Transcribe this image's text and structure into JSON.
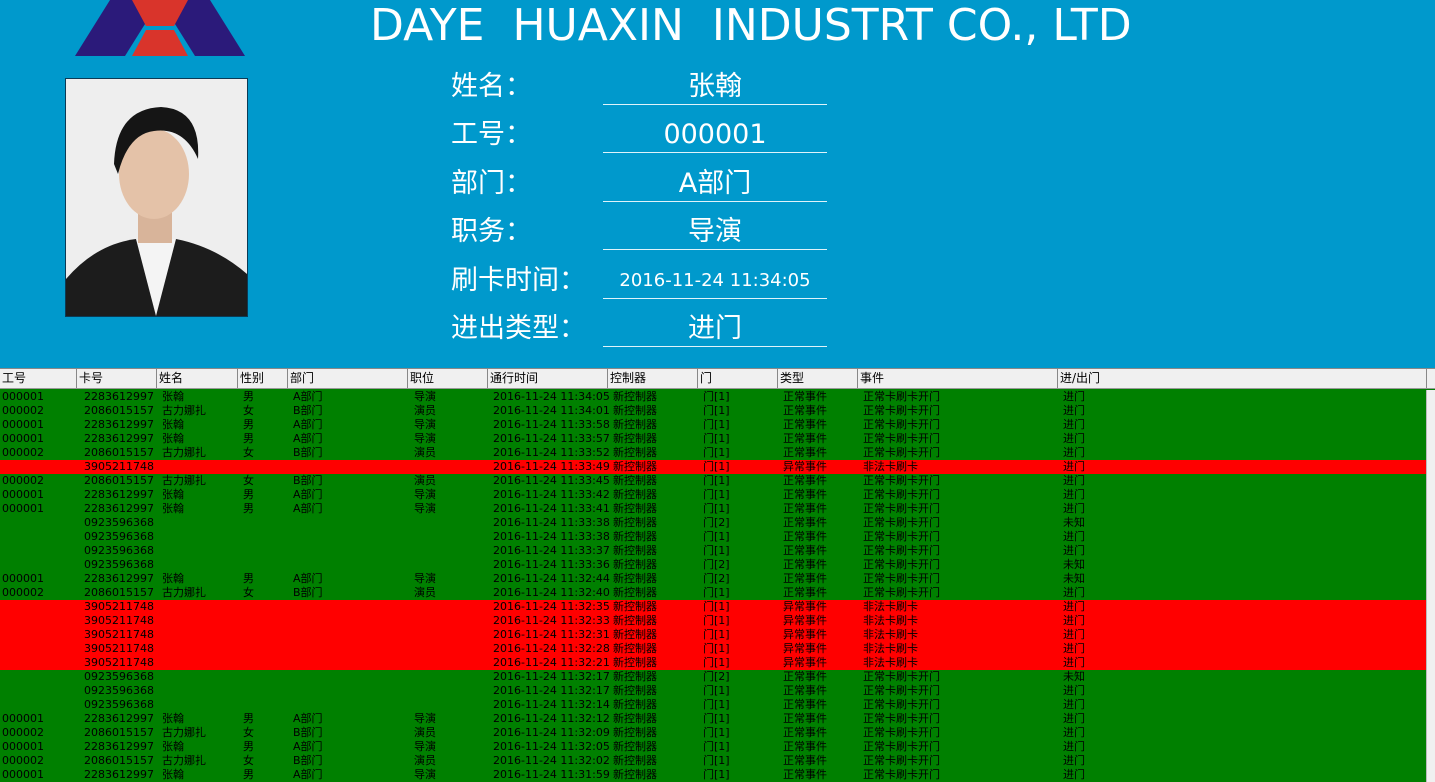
{
  "header": {
    "company": "DAYE  HUAXIN  INDUSTRT CO., LTD",
    "fields": [
      {
        "label": "姓名：",
        "value": "张翰"
      },
      {
        "label": "工号：",
        "value": "000001"
      },
      {
        "label": "部门：",
        "value": "A部门"
      },
      {
        "label": "职务：",
        "value": "导演"
      },
      {
        "label": "刷卡时间：",
        "value": "2016-11-24 11:34:05"
      },
      {
        "label": "进出类型：",
        "value": "进门"
      }
    ]
  },
  "colors": {
    "header_bg": "#0099cc",
    "row_normal": "#008000",
    "row_alarm": "#ff0000"
  },
  "table": {
    "columns": [
      "工号",
      "卡号",
      "姓名",
      "性别",
      "部门",
      "职位",
      "通行时间",
      "控制器",
      "门",
      "类型",
      "事件",
      "进/出门"
    ],
    "rows": [
      [
        "000001",
        "2283612997",
        "张翰",
        "男",
        "A部门",
        "导演",
        "2016-11-24 11:34:05",
        "新控制器",
        "门[1]",
        "正常事件",
        "正常卡刷卡开门",
        "进门"
      ],
      [
        "000002",
        "2086015157",
        "古力娜扎",
        "女",
        "B部门",
        "演员",
        "2016-11-24 11:34:01",
        "新控制器",
        "门[1]",
        "正常事件",
        "正常卡刷卡开门",
        "进门"
      ],
      [
        "000001",
        "2283612997",
        "张翰",
        "男",
        "A部门",
        "导演",
        "2016-11-24 11:33:58",
        "新控制器",
        "门[1]",
        "正常事件",
        "正常卡刷卡开门",
        "进门"
      ],
      [
        "000001",
        "2283612997",
        "张翰",
        "男",
        "A部门",
        "导演",
        "2016-11-24 11:33:57",
        "新控制器",
        "门[1]",
        "正常事件",
        "正常卡刷卡开门",
        "进门"
      ],
      [
        "000002",
        "2086015157",
        "古力娜扎",
        "女",
        "B部门",
        "演员",
        "2016-11-24 11:33:52",
        "新控制器",
        "门[1]",
        "正常事件",
        "正常卡刷卡开门",
        "进门"
      ],
      [
        "",
        "3905211748",
        "",
        "",
        "",
        "",
        "2016-11-24 11:33:49",
        "新控制器",
        "门[1]",
        "异常事件",
        "非法卡刷卡",
        "进门"
      ],
      [
        "000002",
        "2086015157",
        "古力娜扎",
        "女",
        "B部门",
        "演员",
        "2016-11-24 11:33:45",
        "新控制器",
        "门[1]",
        "正常事件",
        "正常卡刷卡开门",
        "进门"
      ],
      [
        "000001",
        "2283612997",
        "张翰",
        "男",
        "A部门",
        "导演",
        "2016-11-24 11:33:42",
        "新控制器",
        "门[1]",
        "正常事件",
        "正常卡刷卡开门",
        "进门"
      ],
      [
        "000001",
        "2283612997",
        "张翰",
        "男",
        "A部门",
        "导演",
        "2016-11-24 11:33:41",
        "新控制器",
        "门[1]",
        "正常事件",
        "正常卡刷卡开门",
        "进门"
      ],
      [
        "",
        "0923596368",
        "",
        "",
        "",
        "",
        "2016-11-24 11:33:38",
        "新控制器",
        "门[2]",
        "正常事件",
        "正常卡刷卡开门",
        "未知"
      ],
      [
        "",
        "0923596368",
        "",
        "",
        "",
        "",
        "2016-11-24 11:33:38",
        "新控制器",
        "门[1]",
        "正常事件",
        "正常卡刷卡开门",
        "进门"
      ],
      [
        "",
        "0923596368",
        "",
        "",
        "",
        "",
        "2016-11-24 11:33:37",
        "新控制器",
        "门[1]",
        "正常事件",
        "正常卡刷卡开门",
        "进门"
      ],
      [
        "",
        "0923596368",
        "",
        "",
        "",
        "",
        "2016-11-24 11:33:36",
        "新控制器",
        "门[2]",
        "正常事件",
        "正常卡刷卡开门",
        "未知"
      ],
      [
        "000001",
        "2283612997",
        "张翰",
        "男",
        "A部门",
        "导演",
        "2016-11-24 11:32:44",
        "新控制器",
        "门[2]",
        "正常事件",
        "正常卡刷卡开门",
        "未知"
      ],
      [
        "000002",
        "2086015157",
        "古力娜扎",
        "女",
        "B部门",
        "演员",
        "2016-11-24 11:32:40",
        "新控制器",
        "门[1]",
        "正常事件",
        "正常卡刷卡开门",
        "进门"
      ],
      [
        "",
        "3905211748",
        "",
        "",
        "",
        "",
        "2016-11-24 11:32:35",
        "新控制器",
        "门[1]",
        "异常事件",
        "非法卡刷卡",
        "进门"
      ],
      [
        "",
        "3905211748",
        "",
        "",
        "",
        "",
        "2016-11-24 11:32:33",
        "新控制器",
        "门[1]",
        "异常事件",
        "非法卡刷卡",
        "进门"
      ],
      [
        "",
        "3905211748",
        "",
        "",
        "",
        "",
        "2016-11-24 11:32:31",
        "新控制器",
        "门[1]",
        "异常事件",
        "非法卡刷卡",
        "进门"
      ],
      [
        "",
        "3905211748",
        "",
        "",
        "",
        "",
        "2016-11-24 11:32:28",
        "新控制器",
        "门[1]",
        "异常事件",
        "非法卡刷卡",
        "进门"
      ],
      [
        "",
        "3905211748",
        "",
        "",
        "",
        "",
        "2016-11-24 11:32:21",
        "新控制器",
        "门[1]",
        "异常事件",
        "非法卡刷卡",
        "进门"
      ],
      [
        "",
        "0923596368",
        "",
        "",
        "",
        "",
        "2016-11-24 11:32:17",
        "新控制器",
        "门[2]",
        "正常事件",
        "正常卡刷卡开门",
        "未知"
      ],
      [
        "",
        "0923596368",
        "",
        "",
        "",
        "",
        "2016-11-24 11:32:17",
        "新控制器",
        "门[1]",
        "正常事件",
        "正常卡刷卡开门",
        "进门"
      ],
      [
        "",
        "0923596368",
        "",
        "",
        "",
        "",
        "2016-11-24 11:32:14",
        "新控制器",
        "门[1]",
        "正常事件",
        "正常卡刷卡开门",
        "进门"
      ],
      [
        "000001",
        "2283612997",
        "张翰",
        "男",
        "A部门",
        "导演",
        "2016-11-24 11:32:12",
        "新控制器",
        "门[1]",
        "正常事件",
        "正常卡刷卡开门",
        "进门"
      ],
      [
        "000002",
        "2086015157",
        "古力娜扎",
        "女",
        "B部门",
        "演员",
        "2016-11-24 11:32:09",
        "新控制器",
        "门[1]",
        "正常事件",
        "正常卡刷卡开门",
        "进门"
      ],
      [
        "000001",
        "2283612997",
        "张翰",
        "男",
        "A部门",
        "导演",
        "2016-11-24 11:32:05",
        "新控制器",
        "门[1]",
        "正常事件",
        "正常卡刷卡开门",
        "进门"
      ],
      [
        "000002",
        "2086015157",
        "古力娜扎",
        "女",
        "B部门",
        "演员",
        "2016-11-24 11:32:02",
        "新控制器",
        "门[1]",
        "正常事件",
        "正常卡刷卡开门",
        "进门"
      ],
      [
        "000001",
        "2283612997",
        "张翰",
        "男",
        "A部门",
        "导演",
        "2016-11-24 11:31:59",
        "新控制器",
        "门[1]",
        "正常事件",
        "正常卡刷卡开门",
        "进门"
      ]
    ]
  }
}
